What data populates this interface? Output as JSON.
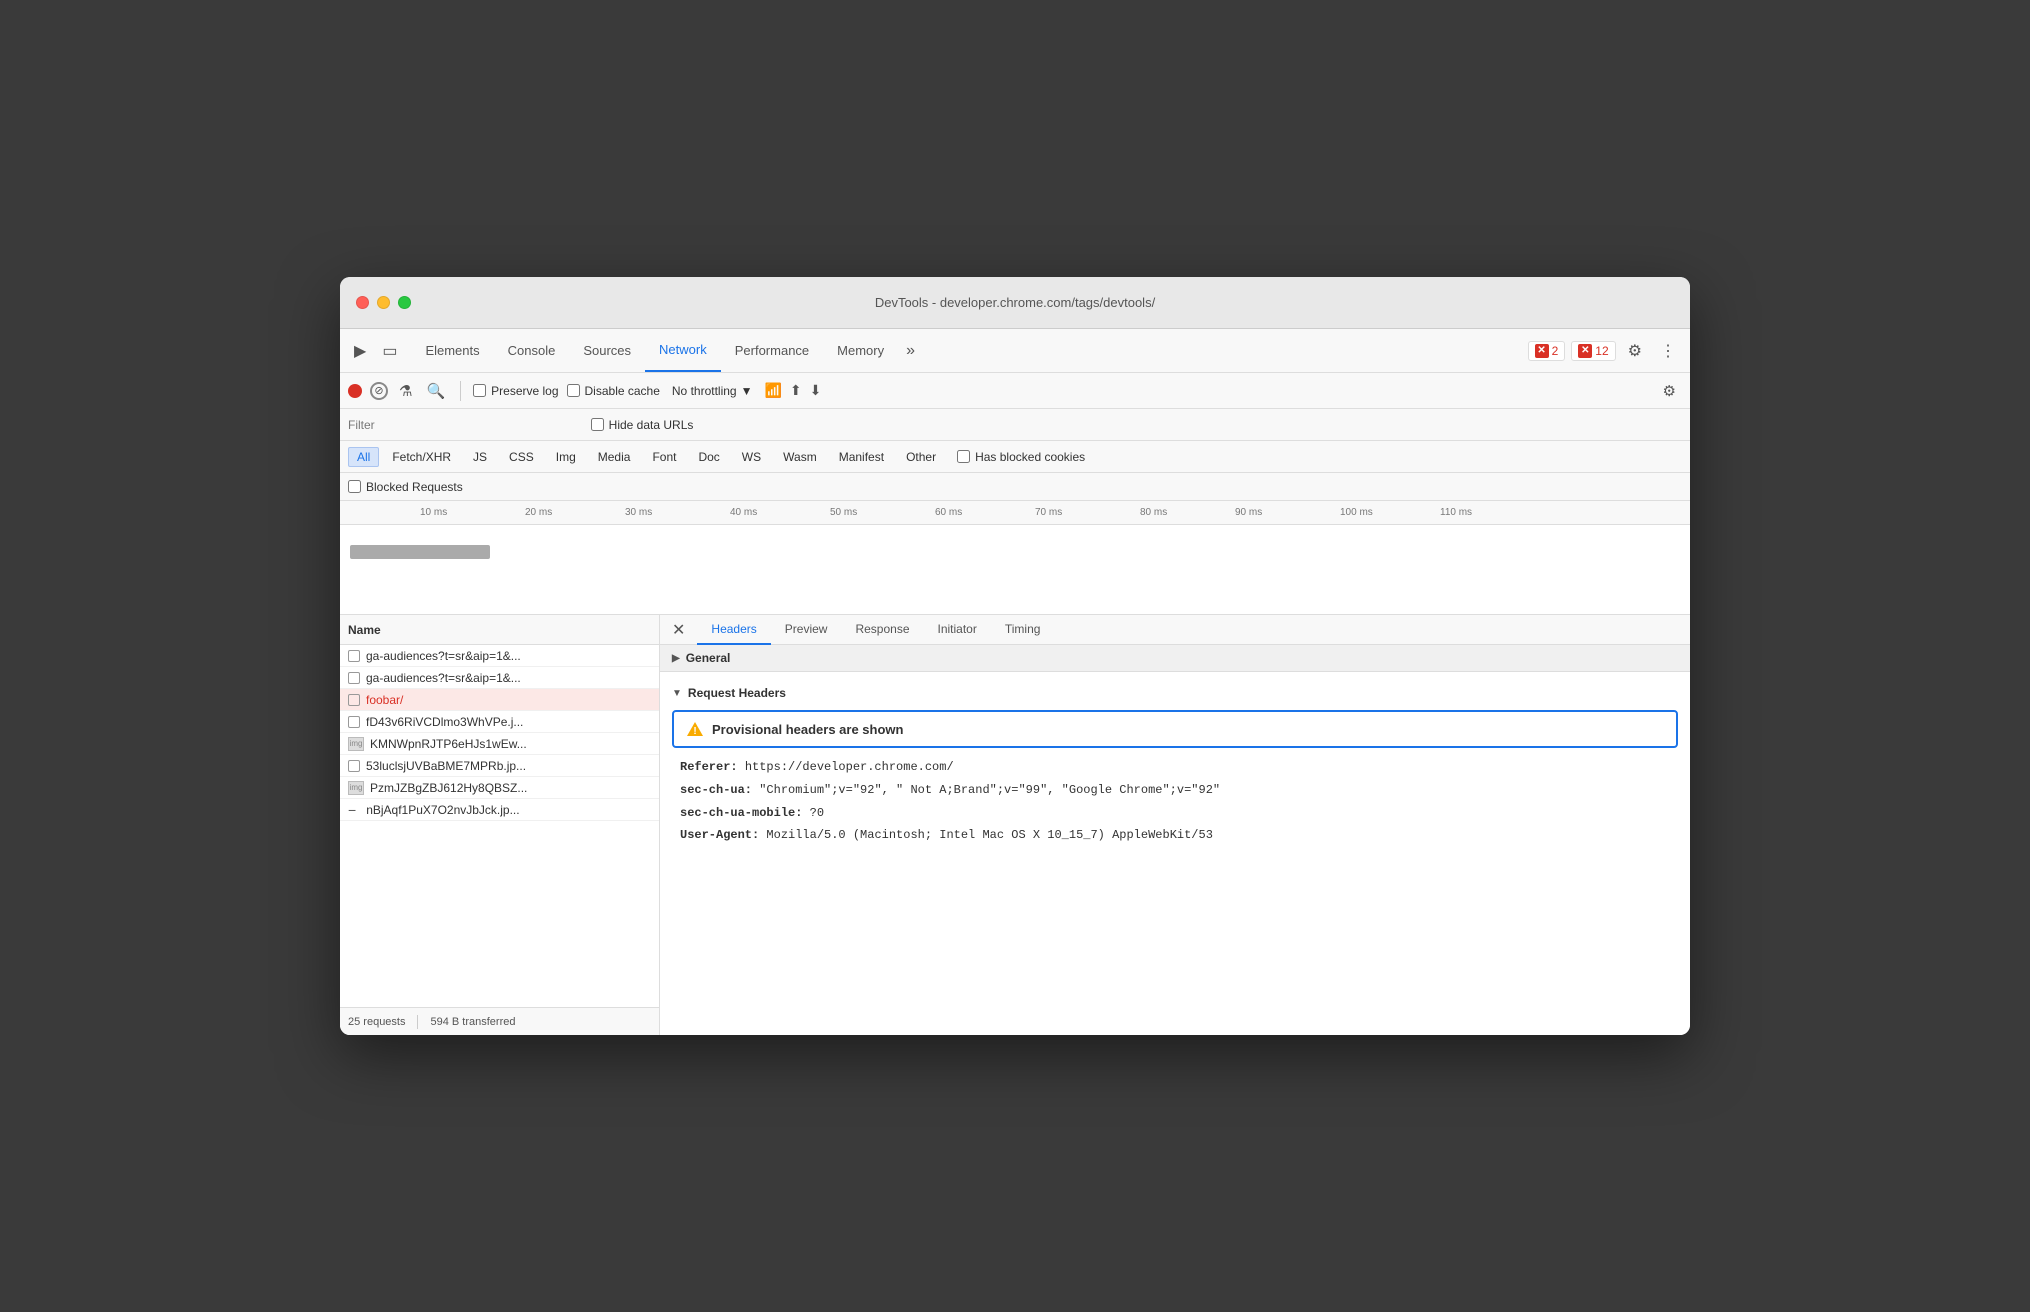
{
  "window": {
    "title": "DevTools - developer.chrome.com/tags/devtools/"
  },
  "tabs": {
    "items": [
      {
        "label": "Elements",
        "active": false
      },
      {
        "label": "Console",
        "active": false
      },
      {
        "label": "Sources",
        "active": false
      },
      {
        "label": "Network",
        "active": true
      },
      {
        "label": "Performance",
        "active": false
      },
      {
        "label": "Memory",
        "active": false
      }
    ],
    "more_label": "»",
    "error_count": "2",
    "warning_count": "12"
  },
  "network_toolbar": {
    "preserve_log_label": "Preserve log",
    "disable_cache_label": "Disable cache",
    "throttle_label": "No throttling"
  },
  "filter_bar": {
    "filter_label": "Filter",
    "hide_urls_label": "Hide data URLs"
  },
  "type_filters": {
    "items": [
      {
        "label": "All",
        "active": true
      },
      {
        "label": "Fetch/XHR",
        "active": false
      },
      {
        "label": "JS",
        "active": false
      },
      {
        "label": "CSS",
        "active": false
      },
      {
        "label": "Img",
        "active": false
      },
      {
        "label": "Media",
        "active": false
      },
      {
        "label": "Font",
        "active": false
      },
      {
        "label": "Doc",
        "active": false
      },
      {
        "label": "WS",
        "active": false
      },
      {
        "label": "Wasm",
        "active": false
      },
      {
        "label": "Manifest",
        "active": false
      },
      {
        "label": "Other",
        "active": false
      }
    ],
    "has_blocked_cookies_label": "Has blocked cookies"
  },
  "blocked_bar": {
    "blocked_requests_label": "Blocked Requests"
  },
  "timeline": {
    "ticks": [
      "10 ms",
      "20 ms",
      "30 ms",
      "40 ms",
      "50 ms",
      "60 ms",
      "70 ms",
      "80 ms",
      "90 ms",
      "100 ms",
      "110 ms"
    ]
  },
  "requests": {
    "header": "Name",
    "items": [
      {
        "name": "ga-audiences?t=sr&aip=1&...",
        "type": "checkbox",
        "selected": false,
        "error": false
      },
      {
        "name": "ga-audiences?t=sr&aip=1&...",
        "type": "checkbox",
        "selected": false,
        "error": false
      },
      {
        "name": "foobar/",
        "type": "checkbox",
        "selected": true,
        "error": true
      },
      {
        "name": "fD43v6RiVCDlmo3WhVPe.j...",
        "type": "checkbox",
        "selected": false,
        "error": false
      },
      {
        "name": "KMNWpnRJTP6eHJs1wEw...",
        "type": "img",
        "selected": false,
        "error": false
      },
      {
        "name": "53luclsjUVBaBME7MPRb.jp...",
        "type": "checkbox",
        "selected": false,
        "error": false
      },
      {
        "name": "PzmJZBgZBJ612Hy8QBSZ...",
        "type": "img",
        "selected": false,
        "error": false
      },
      {
        "name": "nBjAqf1PuX7O2nvJbJck.jp...",
        "type": "minus",
        "selected": false,
        "error": false
      }
    ]
  },
  "status_bar": {
    "requests_label": "25 requests",
    "transferred_label": "594 B transferred"
  },
  "headers_panel": {
    "tabs": [
      {
        "label": "Headers",
        "active": true
      },
      {
        "label": "Preview",
        "active": false
      },
      {
        "label": "Response",
        "active": false
      },
      {
        "label": "Initiator",
        "active": false
      },
      {
        "label": "Timing",
        "active": false
      }
    ],
    "general_label": "General",
    "request_headers_label": "Request Headers",
    "warning_message": "Provisional headers are shown",
    "headers": [
      {
        "key": "Referer:",
        "value": "https://developer.chrome.com/"
      },
      {
        "key": "sec-ch-ua:",
        "value": "\"Chromium\";v=\"92\", \" Not A;Brand\";v=\"99\", \"Google Chrome\";v=\"92\""
      },
      {
        "key": "sec-ch-ua-mobile:",
        "value": "?0"
      },
      {
        "key": "User-Agent:",
        "value": "Mozilla/5.0 (Macintosh; Intel Mac OS X 10_15_7) AppleWebKit/53"
      }
    ]
  }
}
